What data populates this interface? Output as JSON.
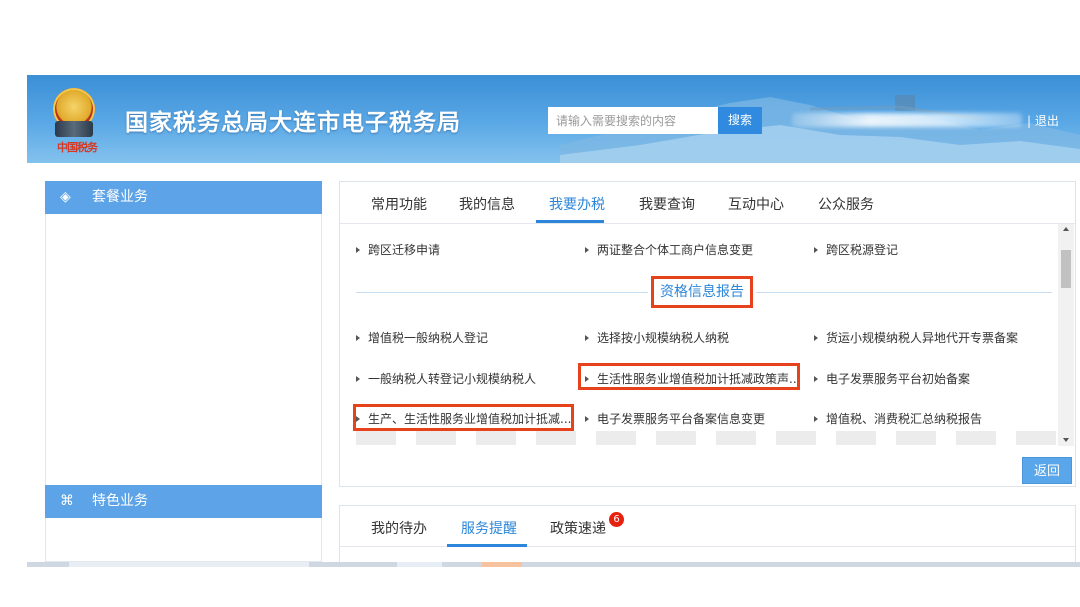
{
  "header": {
    "emblem_caption": "中国税务",
    "site_title": "国家税务总局大连市电子税务局",
    "search": {
      "placeholder": "请输入需要搜索的内容",
      "button_label": "搜索"
    },
    "logout_label": "| 退出"
  },
  "sidebar": {
    "panels": [
      {
        "label": "套餐业务",
        "icon": "layers-icon"
      },
      {
        "label": "特色业务",
        "icon": "grid-icon"
      }
    ]
  },
  "main": {
    "tabs": [
      {
        "label": "常用功能",
        "active": false
      },
      {
        "label": "我的信息",
        "active": false
      },
      {
        "label": "我要办税",
        "active": true
      },
      {
        "label": "我要查询",
        "active": false
      },
      {
        "label": "互动中心",
        "active": false
      },
      {
        "label": "公众服务",
        "active": false
      }
    ],
    "section_title": "资格信息报告",
    "items_top": [
      "跨区迁移申请",
      "两证整合个体工商户信息变更",
      "跨区税源登记"
    ],
    "items": [
      [
        "增值税一般纳税人登记",
        "选择按小规模纳税人纳税",
        "货运小规模纳税人异地代开专票备案"
      ],
      [
        "一般纳税人转登记小规模纳税人",
        "生活性服务业增值税加计抵减政策声..",
        "电子发票服务平台初始备案"
      ],
      [
        "生产、生活性服务业增值税加计抵减...",
        "电子发票服务平台备案信息变更",
        "增值税、消费税汇总纳税报告"
      ]
    ],
    "back_label": "返回"
  },
  "bottom": {
    "tabs": [
      {
        "label": "我的待办",
        "active": false
      },
      {
        "label": "服务提醒",
        "active": true
      },
      {
        "label": "政策速递",
        "active": false,
        "badge": "6"
      }
    ]
  },
  "colors": {
    "accent": "#2b86d9",
    "highlight": "#e8421c",
    "header": "#4a9ce0",
    "badge": "#e8200e"
  }
}
